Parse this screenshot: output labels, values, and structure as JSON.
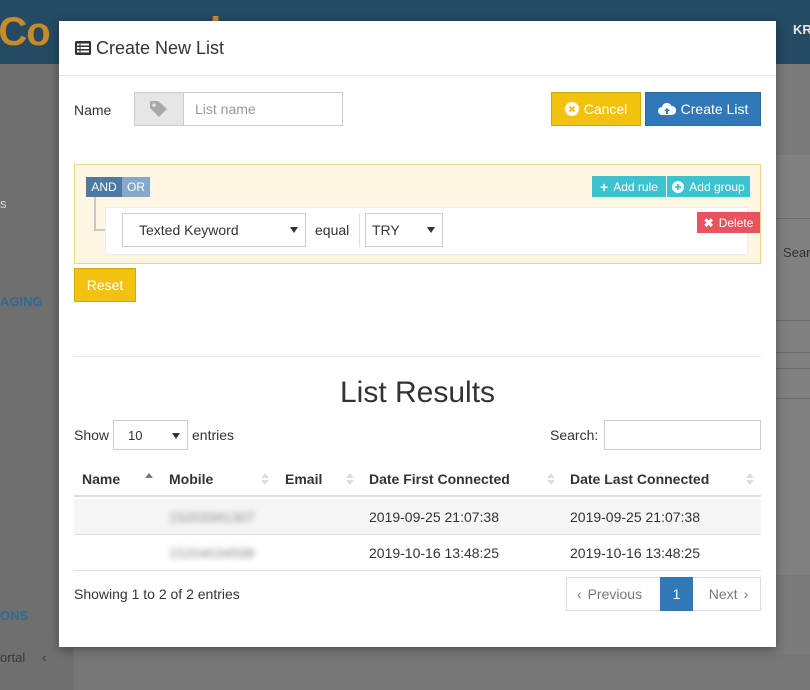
{
  "background": {
    "brand_fragment": "tCo",
    "brand_fragment_2": "k",
    "user_fragment": "KR",
    "sidebar_fragments": [
      "s",
      "AGING",
      "ONS",
      "ortal"
    ],
    "right_fragment": "Sear"
  },
  "modal": {
    "title": "Create New List",
    "name_label": "Name",
    "name_placeholder": "List name",
    "name_value": "",
    "cancel_label": "Cancel",
    "create_label": "Create List"
  },
  "query_builder": {
    "and_label": "AND",
    "or_label": "OR",
    "add_rule_label": "Add rule",
    "add_group_label": "Add group",
    "rule": {
      "field": "Texted Keyword",
      "operator": "equal",
      "value": "TRY"
    },
    "delete_label": "Delete",
    "reset_label": "Reset"
  },
  "results": {
    "title": "List Results",
    "show_label": "Show",
    "page_length": "10",
    "entries_label": "entries",
    "search_label": "Search:",
    "search_value": "",
    "columns": [
      "Name",
      "Mobile",
      "Email",
      "Date First Connected",
      "Date Last Connected"
    ],
    "rows": [
      {
        "name": "",
        "mobile": "15203341307",
        "email": "",
        "first": "2019-09-25 21:07:38",
        "last": "2019-09-25 21:07:38"
      },
      {
        "name": "",
        "mobile": "15204034598",
        "email": "",
        "first": "2019-10-16 13:48:25",
        "last": "2019-10-16 13:48:25"
      }
    ],
    "info": "Showing 1 to 2 of 2 entries",
    "pagination": {
      "previous": "Previous",
      "current": "1",
      "next": "Next"
    }
  },
  "colors": {
    "primary": "#3178b8",
    "warning": "#f3c20f",
    "info": "#3cc3cf",
    "danger": "#e6545f"
  }
}
